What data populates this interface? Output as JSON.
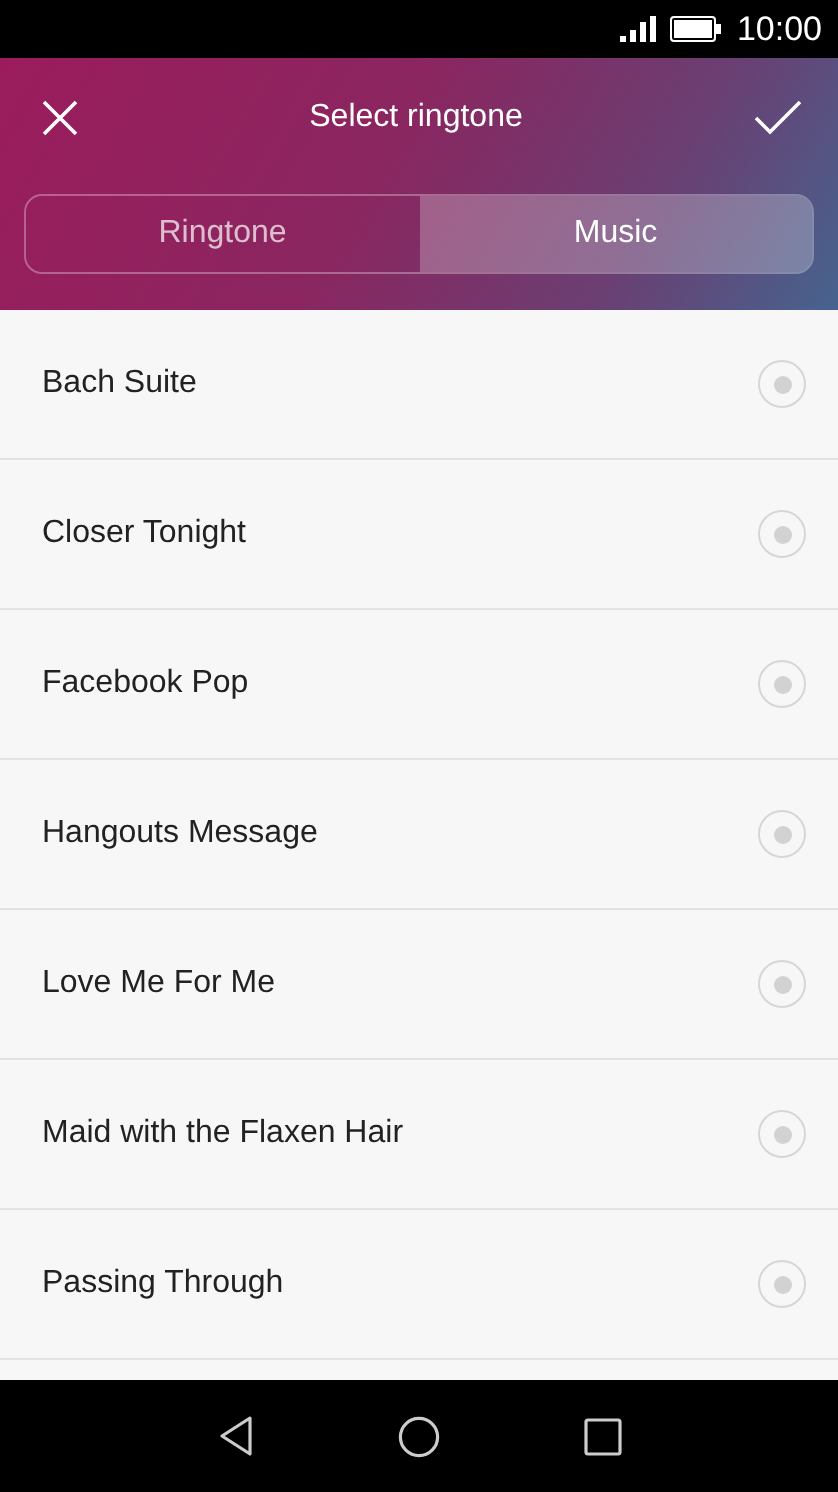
{
  "status_bar": {
    "time": "10:00"
  },
  "header": {
    "title": "Select ringtone"
  },
  "tabs": [
    {
      "label": "Ringtone",
      "selected": false
    },
    {
      "label": "Music",
      "selected": true
    }
  ],
  "songs": [
    {
      "title": "Bach Suite",
      "selected": false
    },
    {
      "title": "Closer Tonight",
      "selected": false
    },
    {
      "title": "Facebook Pop",
      "selected": false
    },
    {
      "title": "Hangouts Message",
      "selected": false
    },
    {
      "title": "Love Me For Me",
      "selected": false
    },
    {
      "title": "Maid with the Flaxen Hair",
      "selected": false
    },
    {
      "title": "Passing Through",
      "selected": false
    }
  ]
}
